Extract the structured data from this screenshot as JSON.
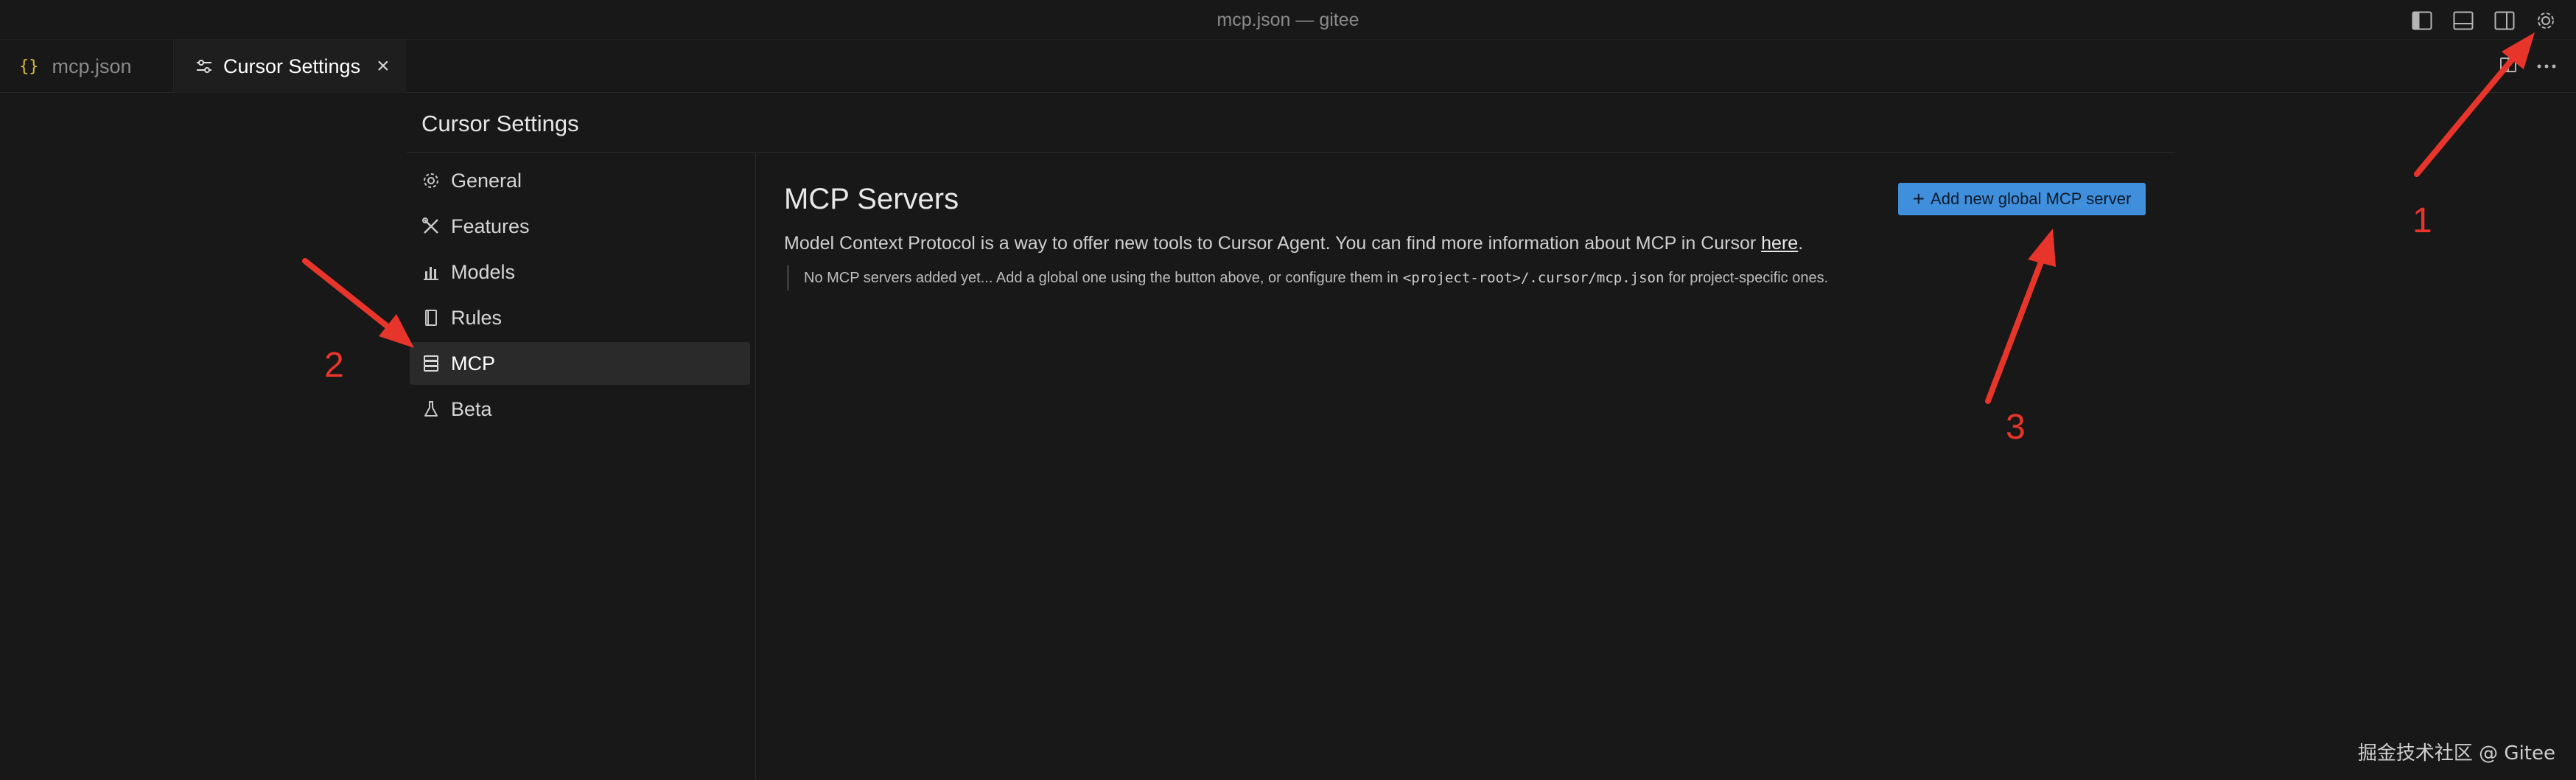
{
  "window": {
    "title": "mcp.json — gitee"
  },
  "tabs": [
    {
      "label": "mcp.json",
      "icon": "json-braces-icon",
      "glyph": "{}"
    },
    {
      "label": "Cursor Settings",
      "icon": "sliders-icon",
      "close": "×"
    }
  ],
  "settings": {
    "title": "Cursor Settings",
    "nav": [
      {
        "label": "General",
        "icon": "gear-icon"
      },
      {
        "label": "Features",
        "icon": "tools-icon"
      },
      {
        "label": "Models",
        "icon": "bar-chart-icon"
      },
      {
        "label": "Rules",
        "icon": "book-icon"
      },
      {
        "label": "MCP",
        "icon": "server-icon",
        "active": true
      },
      {
        "label": "Beta",
        "icon": "flask-icon"
      }
    ]
  },
  "mcp": {
    "title": "MCP Servers",
    "add_button": "Add new global MCP server",
    "add_plus": "+",
    "description_prefix": "Model Context Protocol is a way to offer new tools to Cursor Agent. You can find more information about MCP in Cursor ",
    "description_link": "here",
    "description_suffix": ".",
    "notice_prefix": "No MCP servers added yet... Add a global one using the button above, or configure them in",
    "notice_code": "<project-root>/.cursor/mcp.json",
    "notice_suffix": "for project-specific ones."
  },
  "annotations": {
    "n1": "1",
    "n2": "2",
    "n3": "3",
    "color": "#e8352b"
  },
  "watermark": "掘金技术社区 @ Gitee",
  "colors": {
    "accent": "#3f8fdc",
    "background": "#181818",
    "active_nav": "#2a2a2a"
  }
}
